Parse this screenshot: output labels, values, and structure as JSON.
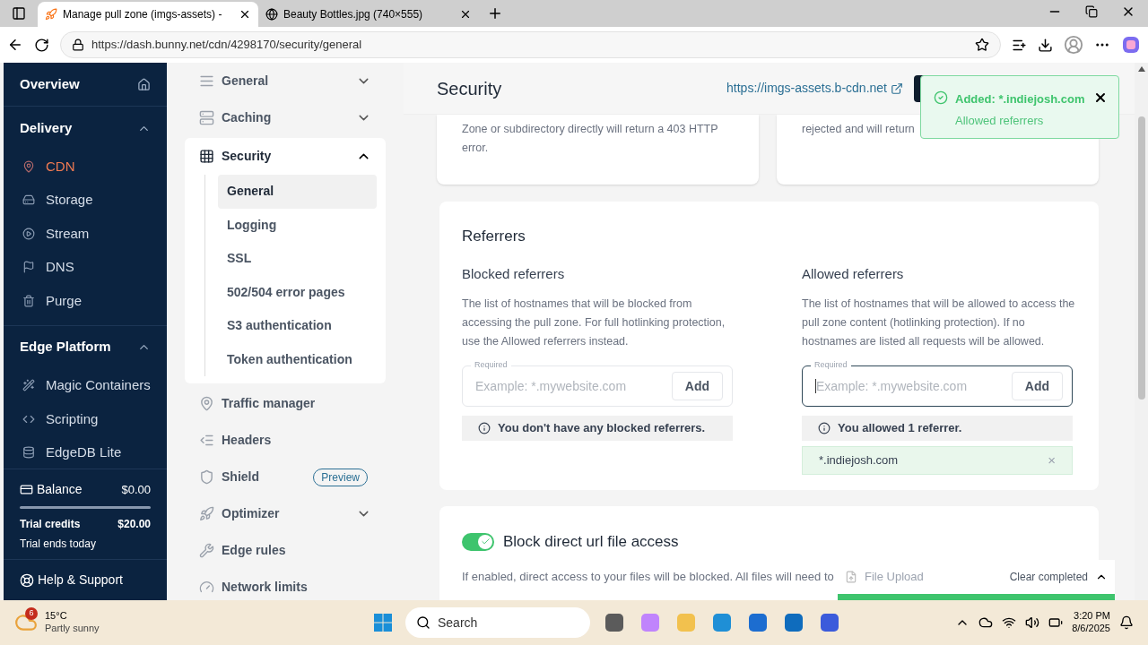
{
  "browser": {
    "tabs": [
      {
        "title": "Manage pull zone (imgs-assets) -",
        "selected": true
      },
      {
        "title": "Beauty Bottles.jpg (740×555)",
        "selected": false
      }
    ],
    "url": "https://dash.bunny.net/cdn/4298170/security/general"
  },
  "sidebar": {
    "sections": [
      {
        "title": "Overview",
        "kind": "link"
      },
      {
        "title": "Delivery",
        "kind": "group",
        "expanded": true,
        "items": [
          {
            "label": "CDN",
            "selected": true
          },
          {
            "label": "Storage",
            "selected": false
          },
          {
            "label": "Stream",
            "selected": false
          },
          {
            "label": "DNS",
            "selected": false
          },
          {
            "label": "Purge",
            "selected": false
          }
        ]
      },
      {
        "title": "Edge Platform",
        "kind": "group",
        "expanded": true,
        "items": [
          {
            "label": "Magic Containers",
            "selected": false
          },
          {
            "label": "Scripting",
            "selected": false
          },
          {
            "label": "EdgeDB Lite",
            "selected": false
          }
        ]
      }
    ],
    "balance": {
      "label": "Balance",
      "amount": "$0.00",
      "credits_label": "Trial credits",
      "credits": "$20.00",
      "note": "Trial ends today"
    },
    "help": "Help & Support"
  },
  "settings_nav": [
    {
      "label": "General",
      "expanded": false
    },
    {
      "label": "Caching",
      "expanded": false
    },
    {
      "label": "Security",
      "expanded": true,
      "children": [
        {
          "label": "General",
          "selected": true
        },
        {
          "label": "Logging",
          "selected": false
        },
        {
          "label": "SSL",
          "selected": false
        },
        {
          "label": "502/504 error pages",
          "selected": false
        },
        {
          "label": "S3 authentication",
          "selected": false
        },
        {
          "label": "Token authentication",
          "selected": false
        }
      ]
    },
    {
      "label": "Traffic manager"
    },
    {
      "label": "Headers"
    },
    {
      "label": "Shield",
      "badge": "Preview"
    },
    {
      "label": "Optimizer",
      "expanded": false
    },
    {
      "label": "Edge rules"
    },
    {
      "label": "Network limits"
    }
  ],
  "header": {
    "title": "Security",
    "link": "https://imgs-assets.b-cdn.net"
  },
  "top_cards": [
    {
      "text": "Zone or subdirectory directly will return a 403 HTTP error."
    },
    {
      "text": "rejected and will return"
    }
  ],
  "referrers": {
    "title": "Referrers",
    "columns": [
      {
        "title": "Blocked referrers",
        "description": "The list of hostnames that will be blocked from accessing the pull zone. For full hotlinking protection, use the Allowed referrers instead.",
        "field_label": "Required",
        "placeholder": "Example: *.mywebsite.com",
        "focused": false,
        "button": "Add",
        "notice": "You don't have any blocked referrers."
      },
      {
        "title": "Allowed referrers",
        "description": "The list of hostnames that will be allowed to access the pull zone content (hotlinking protection). If no hostnames are listed all requests will be allowed.",
        "field_label": "Required",
        "placeholder": "Example: *.mywebsite.com",
        "focused": true,
        "button": "Add",
        "notice": "You allowed 1 referrer.",
        "entries": [
          {
            "host": "*.indiejosh.com",
            "remove": "×"
          }
        ]
      }
    ]
  },
  "direct_access": {
    "label": "Block direct url file access",
    "on": true,
    "description": "If enabled, direct access to your files will be blocked. All files will need to"
  },
  "toast": {
    "title": "Added: *.indiejosh.com",
    "message": "Allowed referrers"
  },
  "upload": {
    "title": "File Upload",
    "action": "Clear completed",
    "level": 1
  },
  "taskbar": {
    "weather": {
      "badge": "6",
      "temp": "15°C",
      "condition": "Partly sunny"
    },
    "search": "Search",
    "time": "3:20 PM",
    "date": "8/6/2025"
  }
}
